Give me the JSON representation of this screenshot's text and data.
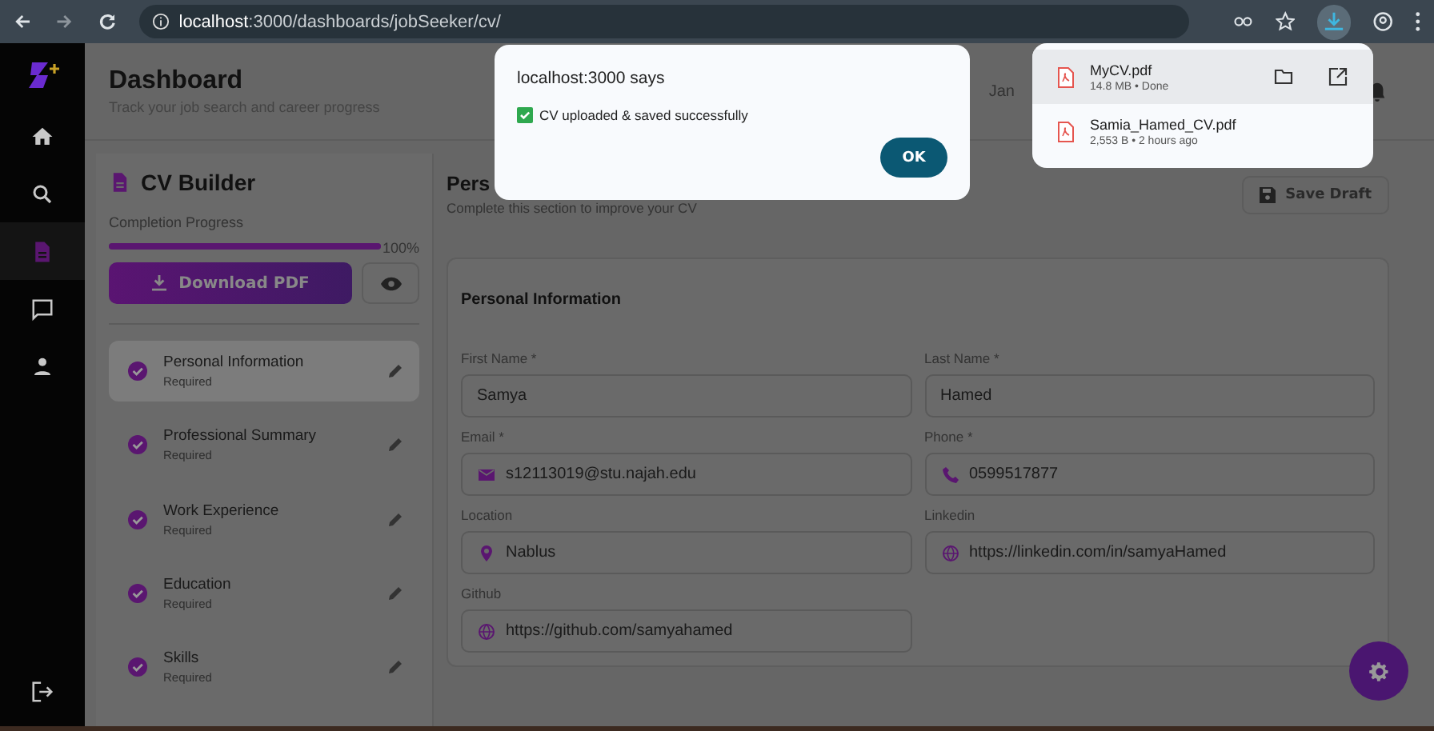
{
  "browser": {
    "url": "**localhost**:3000/dashboards/jobSeeker/cv/"
  },
  "nav": {
    "items": [
      {
        "kind": "home",
        "selected": false
      },
      {
        "kind": "search",
        "selected": false
      },
      {
        "kind": "document",
        "selected": true
      },
      {
        "kind": "chat",
        "selected": false
      },
      {
        "kind": "person",
        "selected": false
      }
    ]
  },
  "header": {
    "title": "Dashboard",
    "subtitle": "Track your job search and career progress",
    "user": "Jan"
  },
  "cv_builder": {
    "title": "CV Builder",
    "progress_label": "Completion Progress",
    "level": 1,
    "progress_text": "100%",
    "download_button": "Download PDF",
    "sections": [
      {
        "label": "Personal Information",
        "status": "Required",
        "done": true,
        "selected": true
      },
      {
        "label": "Professional Summary",
        "status": "Required",
        "done": true,
        "selected": false
      },
      {
        "label": "Work Experience",
        "status": "Required",
        "done": true,
        "selected": false
      },
      {
        "label": "Education",
        "status": "Required",
        "done": true,
        "selected": false
      },
      {
        "label": "Skills",
        "status": "Required",
        "done": true,
        "selected": false
      }
    ]
  },
  "editor": {
    "title": "Pers",
    "subtitle": "Complete this section to improve your CV",
    "save_button": "Save Draft",
    "card_title": "Personal Information",
    "fields": [
      {
        "label": "First Name *",
        "value": "Samya",
        "kind": "text"
      },
      {
        "label": "Last Name *",
        "value": "Hamed",
        "kind": "text"
      },
      {
        "label": "Email *",
        "value": "s12113019@stu.najah.edu",
        "kind": "mail"
      },
      {
        "label": "Phone *",
        "value": "0599517877",
        "kind": "phone"
      },
      {
        "label": "Location",
        "value": "Nablus",
        "kind": "pin"
      },
      {
        "label": "Linkedin",
        "value": "https://linkedin.com/in/samyaHamed",
        "kind": "globe"
      },
      {
        "label": "Github",
        "value": "https://github.com/samyahamed",
        "kind": "globe"
      }
    ]
  },
  "dialog": {
    "title": "localhost:3000 says",
    "message": "CV uploaded & saved successfully",
    "button": "OK"
  },
  "downloads": [
    {
      "name": "MyCV.pdf",
      "meta": "14.8 MB • Done",
      "selected": true
    },
    {
      "name": "Samia_Hamed_CV.pdf",
      "meta": "2,553 B • 2 hours ago",
      "selected": false
    }
  ]
}
